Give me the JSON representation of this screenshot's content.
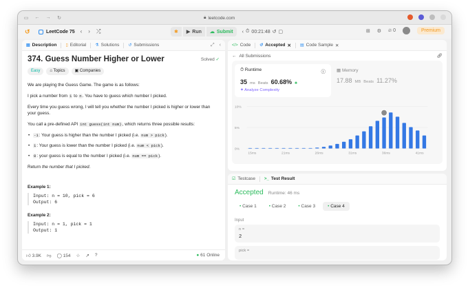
{
  "browser": {
    "url": "leetcode.com"
  },
  "topbar": {
    "list_title": "LeetCode 75",
    "run_label": "Run",
    "submit_label": "Submit",
    "timer": "00:21:48",
    "streak_count": "0",
    "premium_label": "Premium"
  },
  "left": {
    "tabs": [
      {
        "label": "Description"
      },
      {
        "label": "Editorial"
      },
      {
        "label": "Solutions"
      },
      {
        "label": "Submissions"
      }
    ],
    "title": "374. Guess Number Higher or Lower",
    "solved_label": "Solved",
    "chips": {
      "difficulty": "Easy",
      "topics": "Topics",
      "companies": "Companies"
    },
    "p1": "We are playing the Guess Game. The game is as follows:",
    "p2a": "I pick a number from ",
    "p2_code1": "1",
    "p2b": " to ",
    "p2_code2": "n",
    "p2c": ". You have to guess which number I picked.",
    "p3": "Every time you guess wrong, I will tell you whether the number I picked is higher or lower than your guess.",
    "p4a": "You call a pre-defined API ",
    "p4_code": "int guess(int num)",
    "p4b": ", which returns three possible results:",
    "bullets": [
      {
        "code": "-1",
        "text": ": Your guess is higher than the number I picked (i.e. ",
        "code2": "num > pick",
        "end": ")."
      },
      {
        "code": "1",
        "text": ": Your guess is lower than the number I picked (i.e. ",
        "code2": "num < pick",
        "end": ")."
      },
      {
        "code": "0",
        "text": ": your guess is equal to the number I picked (i.e. ",
        "code2": "num == pick",
        "end": ")."
      }
    ],
    "p5a": "Return ",
    "p5_em": "the number that I picked",
    "p5b": ".",
    "ex1_title": "Example 1:",
    "ex1_input": "Input: n = 10, pick = 6",
    "ex1_output": "Output: 6",
    "ex2_title": "Example 2:",
    "ex2_input": "Input: n = 1, pick = 1",
    "ex2_output": "Output: 1",
    "likes": "3.9K",
    "comments": "154",
    "online": "61 Online"
  },
  "right_top": {
    "tabs": [
      {
        "label": "Code"
      },
      {
        "label": "Accepted"
      },
      {
        "label": "Code Sample"
      }
    ],
    "back_label": "All Submissions",
    "runtime_label": "Runtime",
    "runtime_value": "35",
    "runtime_unit": "ms",
    "beats_label": "Beats",
    "runtime_beats": "60.68%",
    "analyze_label": "Analyze Complexity",
    "memory_label": "Memory",
    "memory_value": "17.88",
    "memory_unit": "MB",
    "memory_beats": "11.27%"
  },
  "chart_data": {
    "type": "bar",
    "y_ticks": [
      "10%",
      "5%",
      "0%"
    ],
    "x_ticks": [
      "15ms",
      "21ms",
      "26ms",
      "31ms",
      "36ms",
      "41ms"
    ],
    "ylim": [
      0,
      10
    ],
    "values": [
      0.1,
      0.1,
      0.1,
      0.1,
      0.1,
      0.1,
      0.1,
      0.1,
      0.1,
      0.1,
      0.2,
      0.4,
      0.7,
      1.1,
      1.6,
      2.2,
      3.1,
      4.1,
      5.3,
      6.6,
      7.4,
      8.6,
      7.6,
      6.1,
      5.1,
      4.3,
      3.1
    ],
    "highlight_index": 20,
    "color": "#3478e4"
  },
  "right_bot": {
    "tabs": [
      {
        "label": "Testcase"
      },
      {
        "label": "Test Result"
      }
    ],
    "status": "Accepted",
    "runtime": "Runtime: 46 ms",
    "cases": [
      "Case 1",
      "Case 2",
      "Case 3",
      "Case 4"
    ],
    "input_label": "Input",
    "n_label": "n =",
    "n_value": "2",
    "pick_label": "pick ="
  }
}
